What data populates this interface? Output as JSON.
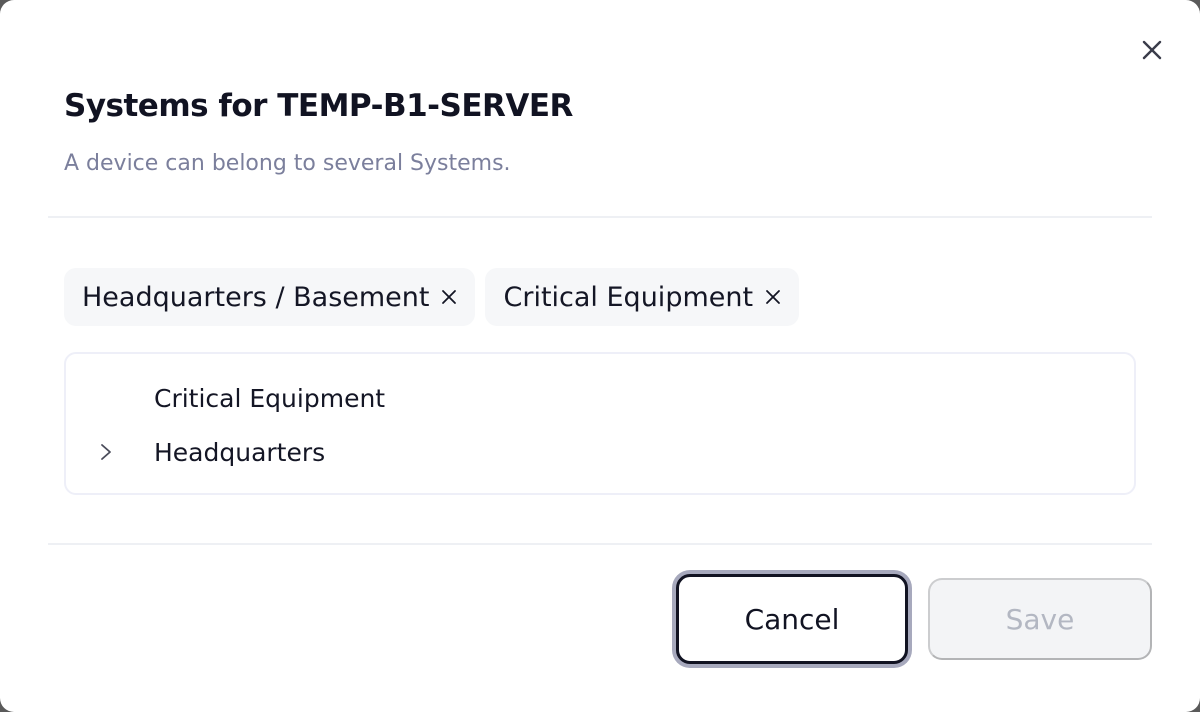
{
  "dialog": {
    "title": "Systems for TEMP-B1-SERVER",
    "subtitle": "A device can belong to several Systems."
  },
  "icons": {
    "close": "close-icon",
    "chip_remove": "x-icon",
    "expand": "chevron-right-icon"
  },
  "chips": [
    {
      "label": "Headquarters / Basement"
    },
    {
      "label": "Critical Equipment"
    }
  ],
  "tree": {
    "items": [
      {
        "label": "Critical Equipment",
        "expandable": false
      },
      {
        "label": "Headquarters",
        "expandable": true
      }
    ]
  },
  "footer": {
    "cancel_label": "Cancel",
    "save_label": "Save",
    "save_disabled": true
  },
  "colors": {
    "text_primary": "#111322",
    "text_secondary": "#7b7f9c",
    "chip_bg": "#f6f7f9",
    "disabled_bg": "#f3f4f6",
    "disabled_text": "#b3b7c2"
  }
}
